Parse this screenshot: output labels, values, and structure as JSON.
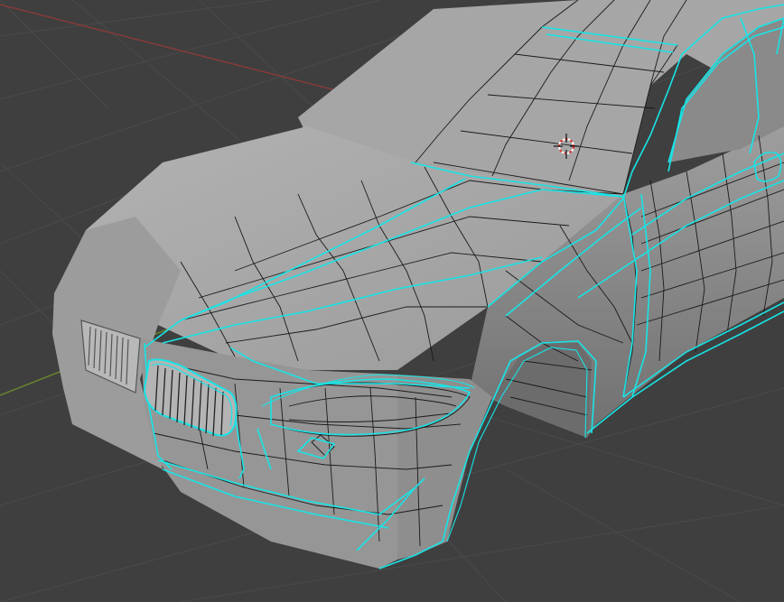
{
  "app": "Blender",
  "viewport": {
    "mode": "edit-mode",
    "object": "car-body-mesh",
    "colors": {
      "background": "#3f3f3f",
      "grid_line": "#4a4a4a",
      "x_axis": "#8c3a3a",
      "y_axis": "#6b8a2e",
      "mesh_surface": "#a8a8a8",
      "mesh_shadow": "#7a7a7a",
      "seam_highlight": "#18e4e6",
      "wire": "#1a1a1a",
      "cursor_red": "#e0342c",
      "cursor_white": "#ffffff"
    },
    "icons": {
      "cursor": "3d-cursor-icon"
    }
  }
}
